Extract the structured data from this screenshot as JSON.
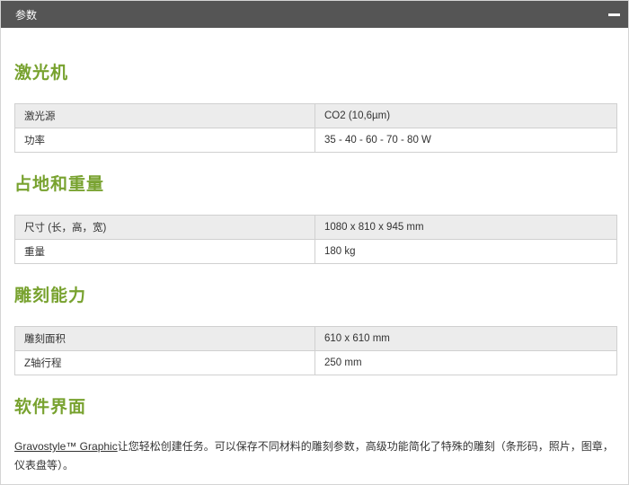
{
  "panel": {
    "title": "参数"
  },
  "sections": [
    {
      "title": "激光机",
      "rows": [
        {
          "key": "激光源",
          "value": "CO2 (10,6µm)"
        },
        {
          "key": "功率",
          "value": "35 - 40 - 60 - 70 - 80 W"
        }
      ]
    },
    {
      "title": "占地和重量",
      "rows": [
        {
          "key": "尺寸 (长，高，宽)",
          "value": "1080 x 810 x 945 mm"
        },
        {
          "key": "重量",
          "value": "180 kg"
        }
      ]
    },
    {
      "title": "雕刻能力",
      "rows": [
        {
          "key": "雕刻面积",
          "value": "610 x 610 mm"
        },
        {
          "key": "Z轴行程",
          "value": "250 mm"
        }
      ]
    },
    {
      "title": "软件界面",
      "link": "Gravostyle™ Graphic",
      "text": "让您轻松创建任务。可以保存不同材料的雕刻参数，高级功能简化了特殊的雕刻（条形码，照片，图章，仪表盘等）。"
    }
  ]
}
